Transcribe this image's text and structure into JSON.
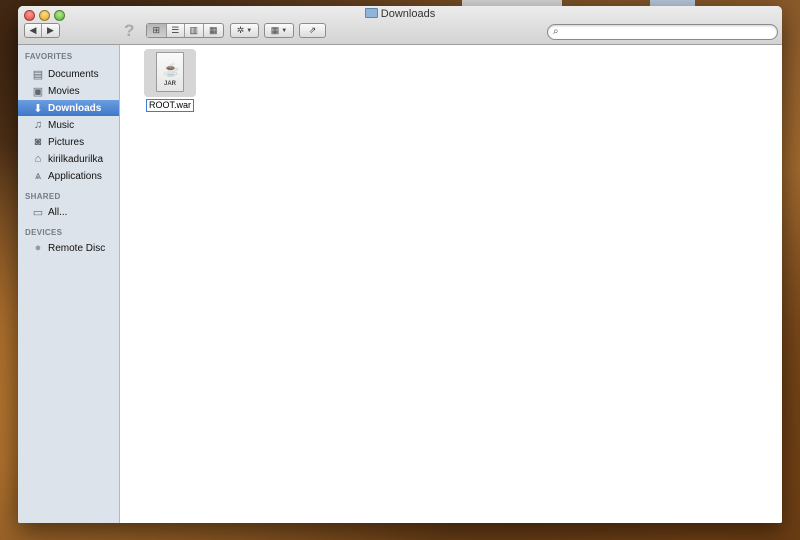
{
  "window": {
    "title": "Downloads",
    "folder_icon": "folder-icon"
  },
  "toolbar": {
    "back_icon": "chevron-left-icon",
    "forward_icon": "chevron-right-icon",
    "help_glyph": "?",
    "view_modes": [
      "icon-view",
      "list-view",
      "column-view",
      "cover-flow-view"
    ],
    "active_view": "icon-view",
    "action_icon": "gear-icon",
    "arrange_icon": "grid-arrange-icon",
    "share_icon": "share-icon",
    "search": {
      "value": "",
      "icon": "search-icon"
    }
  },
  "sidebar": {
    "sections": [
      {
        "title": "FAVORITES",
        "items": [
          {
            "label": "Documents",
            "icon": "documents-icon",
            "glyph": "▤"
          },
          {
            "label": "Movies",
            "icon": "movies-icon",
            "glyph": "▣"
          },
          {
            "label": "Downloads",
            "icon": "downloads-icon",
            "glyph": "⬇",
            "selected": true
          },
          {
            "label": "Music",
            "icon": "music-icon",
            "glyph": "♫"
          },
          {
            "label": "Pictures",
            "icon": "pictures-icon",
            "glyph": "◙"
          },
          {
            "label": "kirilkadurilka",
            "icon": "home-icon",
            "glyph": "⌂"
          },
          {
            "label": "Applications",
            "icon": "applications-icon",
            "glyph": "⩓"
          }
        ]
      },
      {
        "title": "SHARED",
        "items": [
          {
            "label": "All...",
            "icon": "network-computer-icon",
            "glyph": "▭"
          }
        ]
      },
      {
        "title": "DEVICES",
        "items": [
          {
            "label": "Remote Disc",
            "icon": "remote-disc-icon",
            "glyph": "●"
          }
        ]
      }
    ]
  },
  "files": [
    {
      "name": "ROOT.war",
      "type_label": "JAR",
      "icon": "java-archive-icon",
      "selected": true,
      "renaming": true
    }
  ],
  "colors": {
    "selection": "#3f77c9",
    "sidebar_bg": "#dde3ea"
  }
}
